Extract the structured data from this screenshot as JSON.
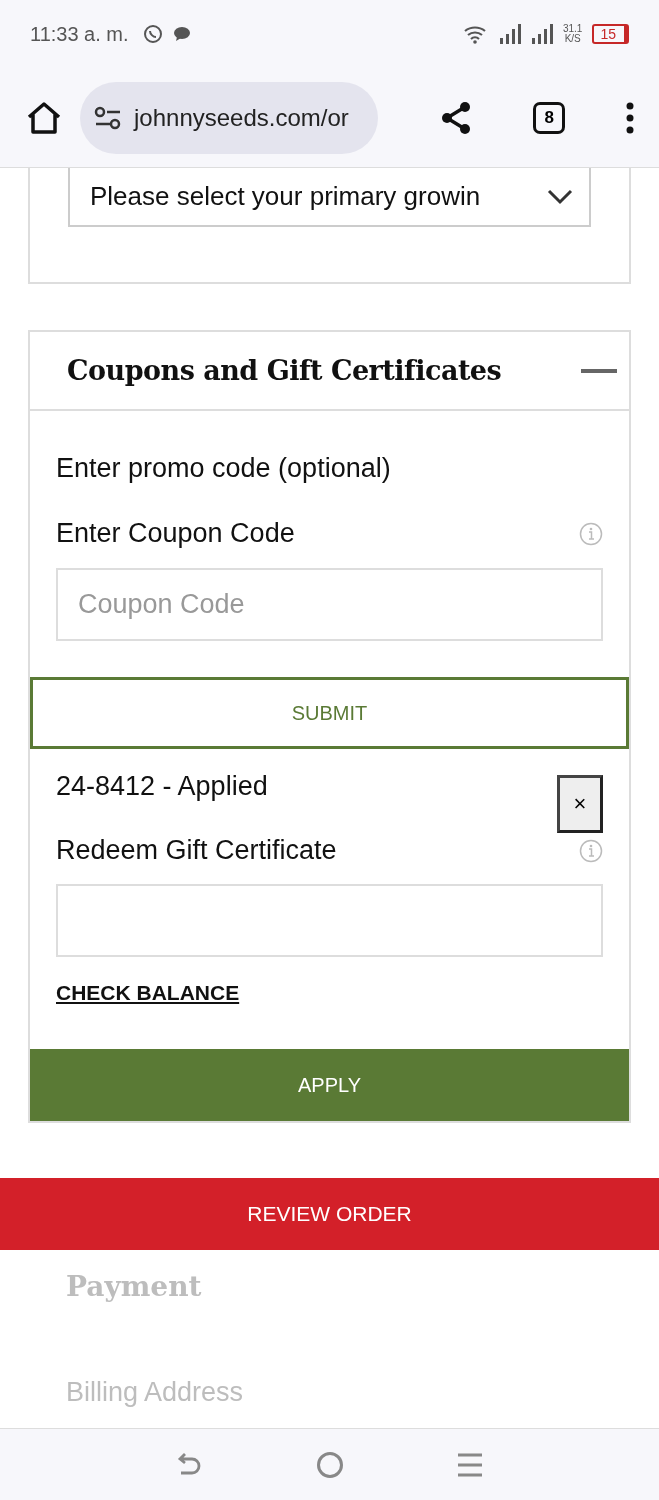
{
  "status_bar": {
    "time": "11:33 a. m.",
    "speed": "31.1",
    "speed_unit": "K/S",
    "battery": "15"
  },
  "browser": {
    "url": "johnnyseeds.com/or",
    "tab_count": "8"
  },
  "growing_select": {
    "value": "Please select your primary growin"
  },
  "coupons": {
    "title": "Coupons and Gift Certificates",
    "expanded": true,
    "promo_label": "Enter promo code (optional)",
    "coupon_label": "Enter Coupon Code",
    "coupon_placeholder": "Coupon Code",
    "submit": "SUBMIT",
    "applied": "24-8412 - Applied",
    "remove": "×",
    "gift_label": "Redeem Gift Certificate",
    "check_balance": "CHECK BALANCE",
    "apply": "APPLY"
  },
  "review_order": "REVIEW ORDER",
  "faded": {
    "payment": "Payment",
    "billing": "Billing Address"
  }
}
